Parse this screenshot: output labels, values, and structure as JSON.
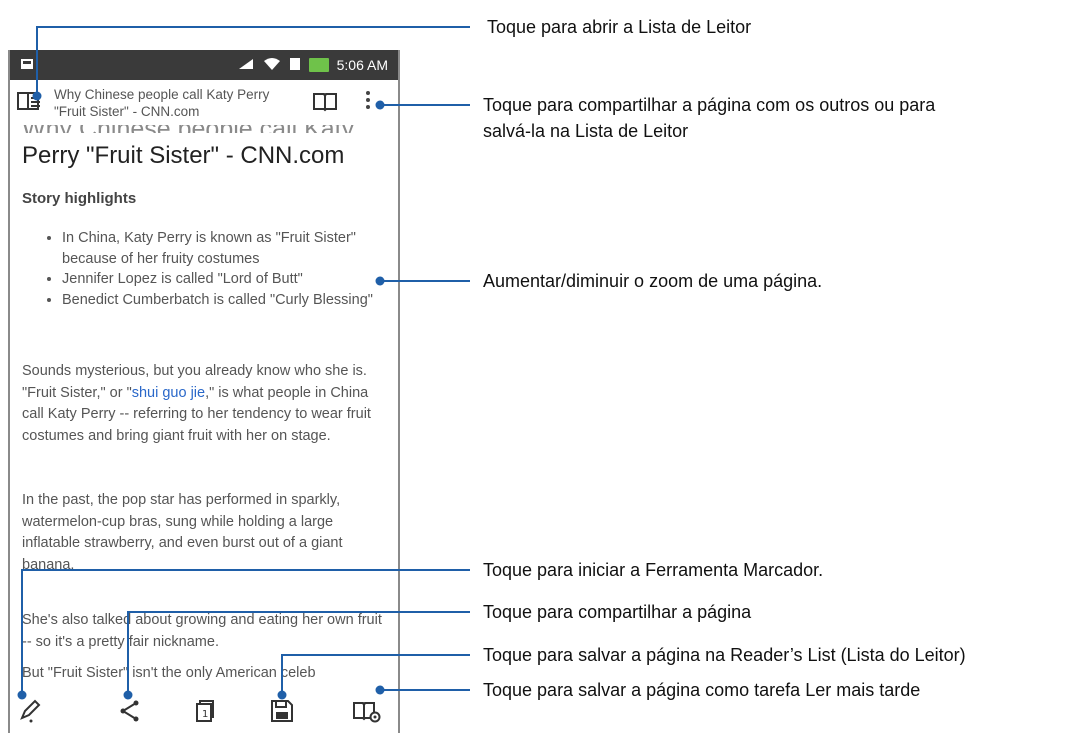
{
  "status_bar": {
    "time": "5:06 AM"
  },
  "app_bar": {
    "page_title": "Why Chinese people call Katy Perry \"Fruit Sister\" - CNN.com"
  },
  "article": {
    "scrolled_title_fragment": "Why Chinese people call Katy",
    "headline": "Perry \"Fruit Sister\" - CNN.com",
    "story_heading": "Story highlights",
    "bullets": [
      "In China, Katy Perry is known as \"Fruit Sister\" because of her fruity costumes",
      "Jennifer Lopez is called \"Lord of Butt\"",
      "Benedict Cumberbatch is called \"Curly Blessing\""
    ],
    "p1_pre": "Sounds mysterious, but you already know who she is. \"Fruit Sister,\" or \"",
    "p1_link": "shui guo jie",
    "p1_post": ",\" is what people in China call Katy Perry -- referring to her tendency to wear fruit costumes and bring giant fruit with her on stage.",
    "p2": "In the past, the pop star has performed in sparkly, watermelon-cup bras, sung while holding a large inflatable strawberry, and even burst out of a giant banana.",
    "p3": "She's also talked about growing and eating her own fruit -- so it's a pretty fair nickname.",
    "p4": "But \"Fruit Sister\" isn't the only American celeb"
  },
  "callouts": {
    "reader_list": "Toque para abrir a Lista de Leitor",
    "share_menu_line1": "Toque para compartilhar a página com os outros ou para",
    "share_menu_line2": "salvá-la na Lista de Leitor",
    "zoom": "Aumentar/diminuir o zoom de uma página.",
    "marker": "Toque para iniciar a Ferramenta Marcador.",
    "share": "Toque para compartilhar a página",
    "save": "Toque para salvar a página na Reader’s List (Lista do Leitor)",
    "read_later": "Toque para salvar a página como tarefa Ler mais tarde"
  },
  "icons": [
    "reader-list-icon",
    "book-icon",
    "overflow-menu-icon",
    "marker-icon",
    "share-icon",
    "copy-icon",
    "save-icon",
    "read-later-icon"
  ],
  "colors": {
    "status_bar": "#3a3a3a",
    "link": "#2a68c9",
    "callout_line": "#1f5fa8",
    "battery": "#6fc24a"
  }
}
